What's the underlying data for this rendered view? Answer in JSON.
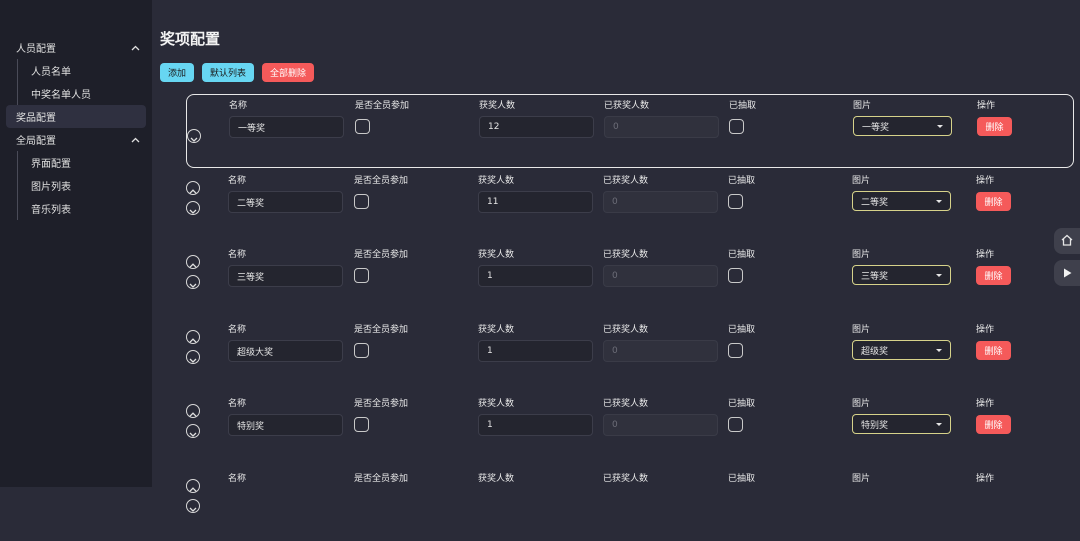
{
  "sidebar": {
    "groups": [
      {
        "label": "人员配置",
        "items": [
          "人员名单",
          "中奖名单人员"
        ]
      },
      {
        "label": "奖品配置",
        "items": []
      },
      {
        "label": "全局配置",
        "items": [
          "界面配置",
          "图片列表",
          "音乐列表"
        ]
      }
    ]
  },
  "page": {
    "title": "奖项配置",
    "add_label": "添加",
    "default_list_label": "默认列表",
    "delete_all_label": "全部删除"
  },
  "columns": {
    "name": "名称",
    "all_participate": "是否全员参加",
    "winners": "获奖人数",
    "won": "已获奖人数",
    "drawn": "已抽取",
    "image": "图片",
    "action": "操作"
  },
  "row_actions": {
    "delete_label": "删除"
  },
  "prizes": [
    {
      "name": "一等奖",
      "winners": "12",
      "won": "0",
      "image": "一等奖"
    },
    {
      "name": "二等奖",
      "winners": "11",
      "won": "0",
      "image": "二等奖"
    },
    {
      "name": "三等奖",
      "winners": "1",
      "won": "0",
      "image": "三等奖"
    },
    {
      "name": "超级大奖",
      "winners": "1",
      "won": "0",
      "image": "超级奖"
    },
    {
      "name": "特别奖",
      "winners": "1",
      "won": "0",
      "image": "特别奖"
    },
    {
      "name": "",
      "winners": "",
      "won": "",
      "image": ""
    }
  ],
  "colors": {
    "accent_cyan": "#67d6f2",
    "danger": "#f55a5a",
    "background": "#2a2b38",
    "sidebar": "#1e1f29"
  },
  "icons": {
    "home": "home-icon",
    "play": "play-icon",
    "up": "chevron-up-circle-icon",
    "down": "chevron-down-circle-icon"
  }
}
